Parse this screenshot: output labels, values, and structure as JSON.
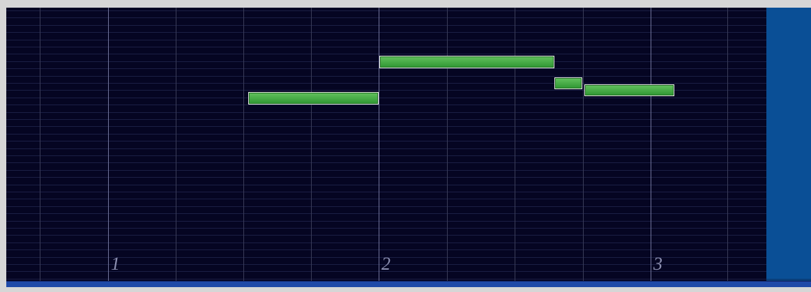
{
  "piano_roll": {
    "bar_numbers": [
      "1",
      "2",
      "3"
    ],
    "notes": [
      {
        "bar": 1,
        "start_beat": 3.75,
        "end_beat": 5.0,
        "pitch_row": 8
      },
      {
        "bar": 2,
        "start_beat": 1.0,
        "end_beat": 2.6,
        "pitch_row": 5
      },
      {
        "bar": 2,
        "start_beat": 2.6,
        "end_beat": 2.9,
        "pitch_row": 6
      },
      {
        "bar": 2,
        "start_beat": 2.9,
        "end_beat": 3.75,
        "pitch_row": 7
      }
    ]
  },
  "colors": {
    "background": "#050522",
    "grid_row": "#1b1f45",
    "beat_line": "#3a3c58",
    "bar_line": "#70739a",
    "note_fill": "#3aa83c",
    "note_border": "#e8efe4",
    "side_panel": "#0a4f96",
    "bottom_bar": "#1f4aa8"
  }
}
